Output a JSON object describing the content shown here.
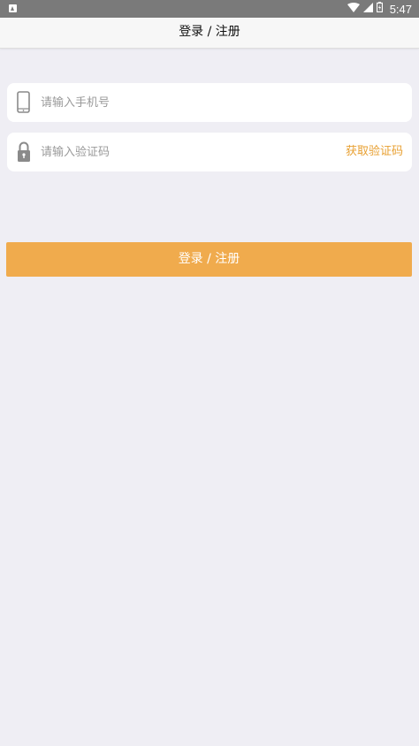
{
  "status_bar": {
    "time": "5:47",
    "icons": [
      "notification-icon",
      "wifi-icon",
      "signal-icon",
      "battery-icon"
    ]
  },
  "header": {
    "title": "登录 / 注册"
  },
  "phone_field": {
    "icon": "phone-icon",
    "value": "",
    "placeholder": "请输入手机号"
  },
  "code_field": {
    "icon": "lock-icon",
    "value": "",
    "placeholder": "请输入验证码",
    "get_code_label": "获取验证码"
  },
  "submit_button": {
    "label": "登录 / 注册"
  },
  "colors": {
    "accent": "#f0ab4d",
    "accent_text": "#e8a032",
    "background": "#efeef4",
    "status_bar": "#7a7a7a"
  }
}
